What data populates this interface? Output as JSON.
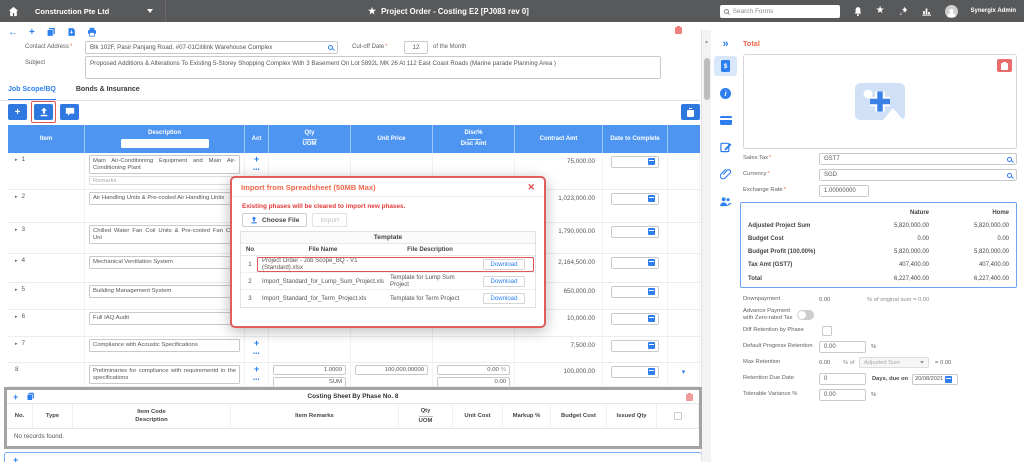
{
  "icons": {
    "add": "+",
    "more": "•••",
    "expand": "▸",
    "dropdown": "▾",
    "collapse": "»",
    "back": "←",
    "favorite": "★",
    "scroll_up": "▲"
  },
  "topbar": {
    "company": "Construction Pte Ltd",
    "title": "Project Order - Costing E2 [PJ083 rev 0]",
    "search_placeholder": "Search Forms",
    "user": "Synergix Admin"
  },
  "form": {
    "contact_address": {
      "label": "Contact Address",
      "required": "*",
      "value": "Blk 102F, Pasir Panjang Road, #07-01Citilink Warehouse Complex"
    },
    "cutoff": {
      "label": "Cut-off Date",
      "required": "*",
      "value": "12",
      "suffix": "of the Month"
    },
    "subject": {
      "label": "Subject",
      "value": "Proposed Additions & Alterations To Existing 5-Storey Shopping Complex With 3 Basement On Lot 5892L MK 26 At 112 East Coast Roads (Marine parade Planning Area )"
    }
  },
  "tabs": {
    "job_scope": "Job Scope/BQ",
    "bonds": "Bonds & Insurance"
  },
  "bq_table": {
    "columns": {
      "item": "Item",
      "description": "Description",
      "act": "Act",
      "qty": "Qty",
      "uom": "UOM",
      "unit_price": "Unit Price",
      "disc_pct": "Disc%",
      "disc_amt": "Disc Amt",
      "contract_amt": "Contract Amt",
      "date_to_complete": "Date to Complete"
    },
    "rows": [
      {
        "num": "1",
        "expandable": true,
        "description": "Main Air-Conditioning Equipment and Main Air-Conditioning Plant",
        "remarks_placeholder": "Remarks",
        "contract_amt": "75,000.00"
      },
      {
        "num": "2",
        "expandable": true,
        "description": "Air Handling Units & Pre-cooled Air Handling Units",
        "contract_amt": "1,023,000.00"
      },
      {
        "num": "3",
        "expandable": true,
        "description": "Chilled Water Fan Coil Units & Pre-cooled Fan Coil Uni",
        "contract_amt": "1,790,000.00"
      },
      {
        "num": "4",
        "expandable": true,
        "description": "Mechanical Ventilation System",
        "contract_amt": "2,164,500.00"
      },
      {
        "num": "5",
        "expandable": true,
        "description": "Building Management System",
        "contract_amt": "650,000.00"
      },
      {
        "num": "6",
        "expandable": true,
        "description": "Full IAQ Audit",
        "contract_amt": "10,000.00"
      },
      {
        "num": "7",
        "expandable": true,
        "description": "Compliance with Acoustic Specifications",
        "contract_amt": "7,500.00"
      },
      {
        "num": "8",
        "expandable": false,
        "description": "Preliminaries for compliance with requirementd in the specifications",
        "qty": "1.0000",
        "uom": "SUM",
        "unit_price": "100,000.00000",
        "disc_pct": "0.00",
        "disc_pct_suffix": "%",
        "disc_amt": "0.00",
        "contract_amt": "100,000.00",
        "caret": true
      }
    ]
  },
  "modal": {
    "title": "Import from Spreadsheet (50MB Max)",
    "close": "✕",
    "warning": "Existing phases will be cleared to import new phases.",
    "choose_file_label": "Choose File",
    "import_label": "Import",
    "table_caption": "Template",
    "col_no": "No",
    "col_file_name": "File Name",
    "col_file_description": "File Description",
    "download_label": "Download",
    "rows": [
      {
        "no": "1",
        "file_name": "Project Order - Job Scope_BQ - V1 (Standard).xlsx",
        "file_description": "",
        "highlighted": true
      },
      {
        "no": "2",
        "file_name": "Import_Standard_for_Lump_Sum_Project.xls",
        "file_description": "Template for Lump Sum Project",
        "highlighted": false
      },
      {
        "no": "3",
        "file_name": "Import_Standard_for_Term_Project.xls",
        "file_description": "Template for Term Project",
        "highlighted": false
      }
    ]
  },
  "costing_sheet": {
    "title": "Costing Sheet By Phase No. 8",
    "columns": [
      {
        "label": "No."
      },
      {
        "label": "Type"
      },
      {
        "label": "Item Code",
        "label2": "Description"
      },
      {
        "label": "Item Remarks"
      },
      {
        "label": "Qty",
        "divider": true,
        "label2": "UOM"
      },
      {
        "label": "Unit Cost"
      },
      {
        "label": "Markup %"
      },
      {
        "label": "Budget Cost"
      },
      {
        "label": "Issued Qty"
      }
    ],
    "empty_text": "No records found."
  },
  "right_panel": {
    "title": "Total",
    "sales_tax": {
      "label": "Sales Tax",
      "required": "*",
      "value": "GST7"
    },
    "currency": {
      "label": "Currency",
      "required": "*",
      "value": "SGD"
    },
    "exchange_rate": {
      "label": "Exchange Rate",
      "required": "*",
      "value": "1.00000000"
    },
    "summary": {
      "col_nature": "Nature",
      "col_home": "Home",
      "rows": [
        {
          "label": "Adjusted Project Sum",
          "nature": "5,820,000.00",
          "home": "5,820,000.00"
        },
        {
          "label": "Budget Cost",
          "nature": "0.00",
          "home": "0.00"
        },
        {
          "label": "Budget Profit (100.00%)",
          "nature": "5,820,000.00",
          "home": "5,820,000.00"
        },
        {
          "label": "Tax Amt (GST7)",
          "nature": "407,400.00",
          "home": "407,400.00"
        },
        {
          "label": "Total",
          "nature": "6,227,400.00",
          "home": "6,227,400.00"
        }
      ]
    },
    "downpayment": {
      "label": "Downpayment",
      "value": "0.00",
      "suffix": "% of original sum =  0.00"
    },
    "advance": {
      "label": "Advance Payment with Zero-rated Tax"
    },
    "diff_retention": {
      "label": "Diff Retention by Phase"
    },
    "default_retention": {
      "label": "Default Progress Retention",
      "value": "0.00",
      "unit": "%"
    },
    "max_retention": {
      "label": "Max Retention",
      "value": "0.00",
      "mid": "% of",
      "select_value": "Adjusted Sum",
      "result": "=  0.00"
    },
    "retention_due": {
      "label": "Retention Due Date",
      "value": "0",
      "mid": "Days, due on",
      "date": "20/08/2021"
    },
    "tolerable": {
      "label": "Tolerable Variance %",
      "value": "0.00",
      "unit": "%"
    }
  }
}
